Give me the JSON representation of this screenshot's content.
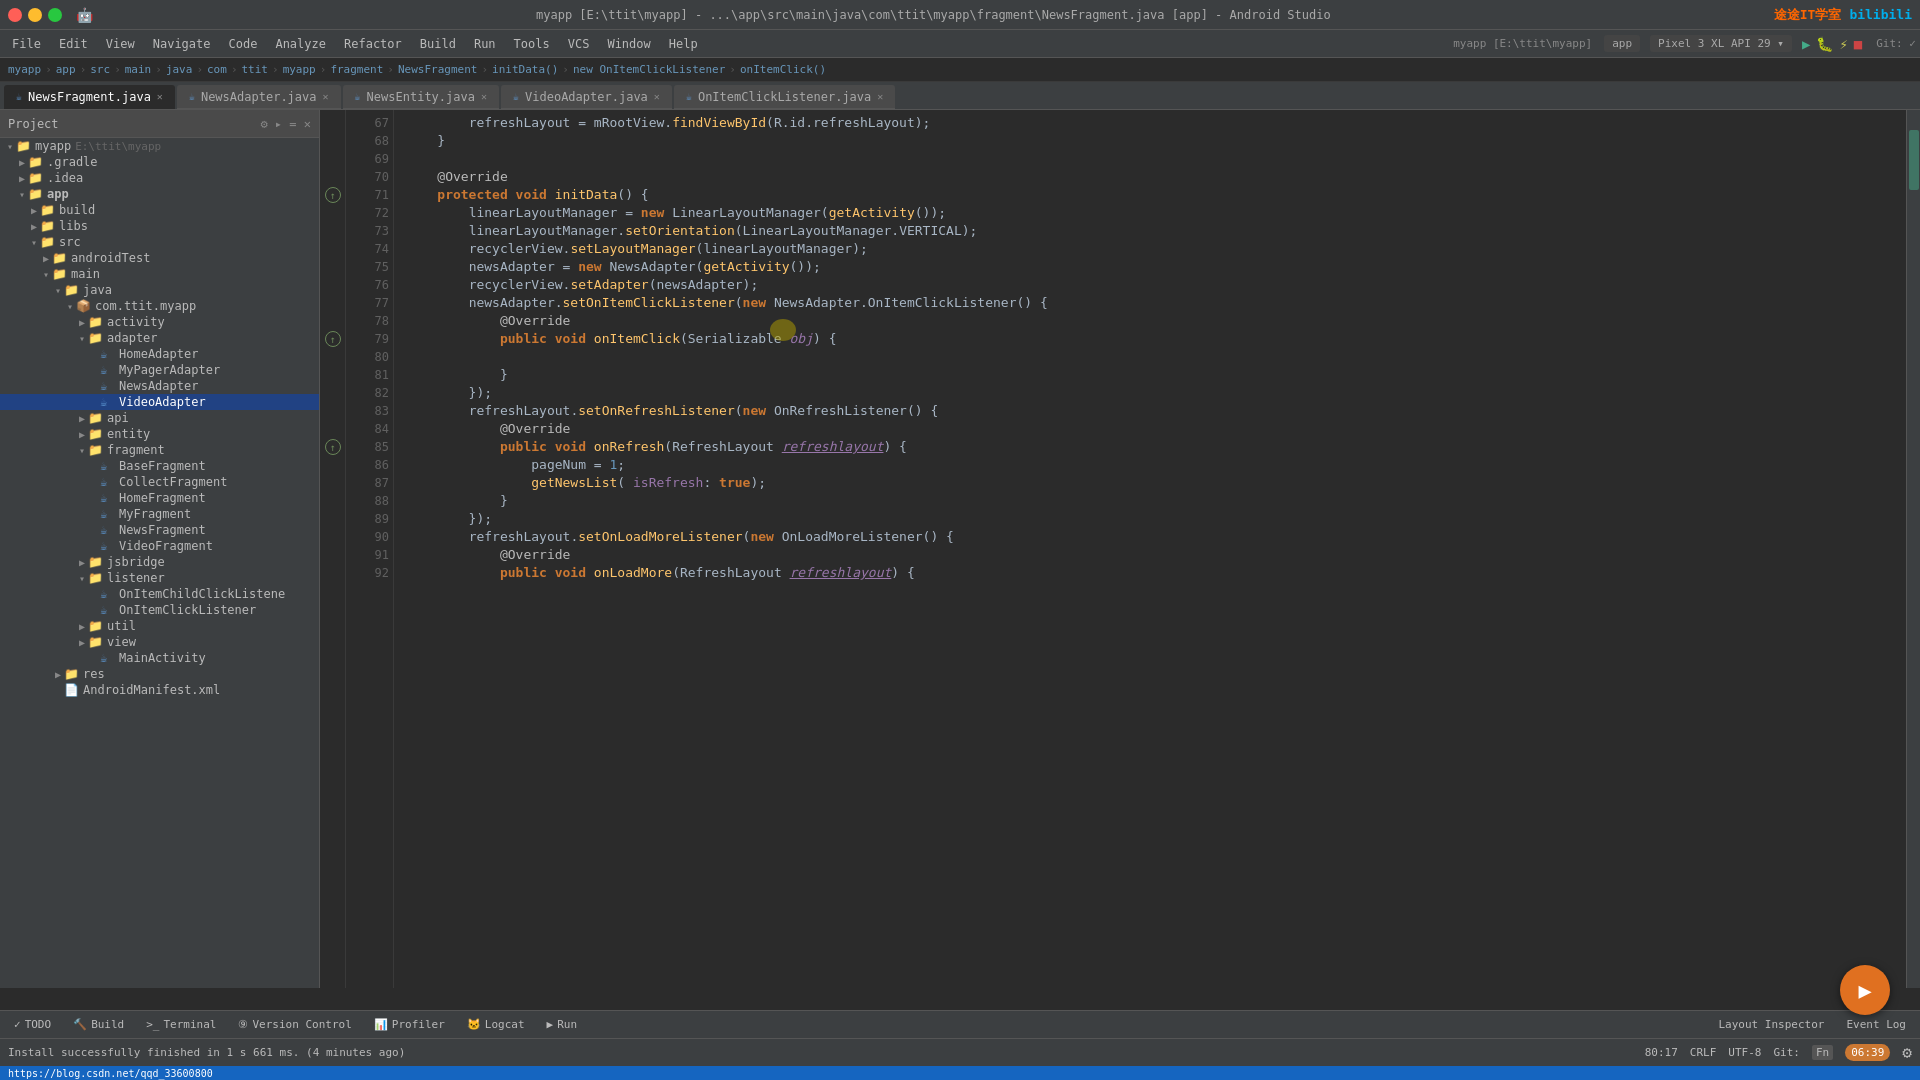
{
  "window": {
    "title": "myapp [E:\\ttit\\myapp] - ...\\app\\src\\main\\java\\com\\ttit\\myapp\\fragment\\NewsFragment.java [app] - Android Studio",
    "window_controls": [
      "close",
      "minimize",
      "maximize"
    ]
  },
  "menu": {
    "items": [
      "File",
      "Edit",
      "View",
      "Navigate",
      "Code",
      "Analyze",
      "Refactor",
      "Build",
      "Run",
      "Tools",
      "VCS",
      "Window",
      "Help"
    ]
  },
  "toolbar": {
    "project_name": "myapp",
    "device": "Pixel 3 XL API 29",
    "run_app": "app",
    "git_label": "Git:",
    "run_icon": "▶",
    "stop_icon": "■",
    "debug_icon": "🐛"
  },
  "breadcrumb": {
    "parts": [
      "myapp",
      "app",
      "src",
      "main",
      "java",
      "com",
      "ttit",
      "myapp",
      "fragment",
      "NewsFragment",
      "initData()",
      "new OnItemClickListener",
      "onItemClick()"
    ]
  },
  "tabs": [
    {
      "name": "NewsFragment.java",
      "active": true
    },
    {
      "name": "NewsAdapter.java",
      "active": false
    },
    {
      "name": "NewsEntity.java",
      "active": false
    },
    {
      "name": "VideoAdapter.java",
      "active": false
    },
    {
      "name": "OnItemClickListener.java",
      "active": false
    }
  ],
  "sidebar": {
    "header": "Project",
    "tree": [
      {
        "indent": 0,
        "icon": "folder",
        "name": "myapp",
        "path": "E:\\ttit\\myapp",
        "expanded": true
      },
      {
        "indent": 1,
        "icon": "folder",
        "name": ".gradle",
        "expanded": false
      },
      {
        "indent": 1,
        "icon": "folder",
        "name": ".idea",
        "expanded": false
      },
      {
        "indent": 1,
        "icon": "folder",
        "name": "app",
        "expanded": true,
        "bold": true
      },
      {
        "indent": 2,
        "icon": "folder",
        "name": "build",
        "expanded": false
      },
      {
        "indent": 2,
        "icon": "folder",
        "name": "libs",
        "expanded": false
      },
      {
        "indent": 2,
        "icon": "folder",
        "name": "src",
        "expanded": true
      },
      {
        "indent": 3,
        "icon": "folder",
        "name": "androidTest",
        "expanded": false
      },
      {
        "indent": 3,
        "icon": "folder",
        "name": "main",
        "expanded": true
      },
      {
        "indent": 4,
        "icon": "folder",
        "name": "java",
        "expanded": true
      },
      {
        "indent": 5,
        "icon": "package",
        "name": "com.ttit.myapp",
        "expanded": true
      },
      {
        "indent": 6,
        "icon": "folder",
        "name": "activity",
        "expanded": false
      },
      {
        "indent": 6,
        "icon": "folder",
        "name": "adapter",
        "expanded": true
      },
      {
        "indent": 7,
        "icon": "java",
        "name": "HomeAdapter",
        "expanded": false
      },
      {
        "indent": 7,
        "icon": "java",
        "name": "MyPagerAdapter",
        "expanded": false
      },
      {
        "indent": 7,
        "icon": "java",
        "name": "NewsAdapter",
        "expanded": false
      },
      {
        "indent": 7,
        "icon": "java",
        "name": "VideoAdapter",
        "expanded": false,
        "selected": true
      },
      {
        "indent": 6,
        "icon": "folder",
        "name": "api",
        "expanded": false
      },
      {
        "indent": 6,
        "icon": "folder",
        "name": "entity",
        "expanded": false
      },
      {
        "indent": 6,
        "icon": "folder",
        "name": "fragment",
        "expanded": true
      },
      {
        "indent": 7,
        "icon": "java",
        "name": "BaseFragment",
        "expanded": false
      },
      {
        "indent": 7,
        "icon": "java",
        "name": "CollectFragment",
        "expanded": false
      },
      {
        "indent": 7,
        "icon": "java",
        "name": "HomeFragment",
        "expanded": false
      },
      {
        "indent": 7,
        "icon": "java",
        "name": "MyFragment",
        "expanded": false
      },
      {
        "indent": 7,
        "icon": "java",
        "name": "NewsFragment",
        "expanded": false
      },
      {
        "indent": 7,
        "icon": "java",
        "name": "VideoFragment",
        "expanded": false
      },
      {
        "indent": 6,
        "icon": "folder",
        "name": "jsbridge",
        "expanded": false
      },
      {
        "indent": 6,
        "icon": "folder",
        "name": "listener",
        "expanded": true
      },
      {
        "indent": 7,
        "icon": "java",
        "name": "OnItemChildClickListene",
        "expanded": false
      },
      {
        "indent": 7,
        "icon": "java",
        "name": "OnItemClickListener",
        "expanded": false
      },
      {
        "indent": 6,
        "icon": "folder",
        "name": "util",
        "expanded": false
      },
      {
        "indent": 6,
        "icon": "folder",
        "name": "view",
        "expanded": false
      },
      {
        "indent": 7,
        "icon": "java",
        "name": "MainActivity",
        "expanded": false
      },
      {
        "indent": 4,
        "icon": "folder",
        "name": "res",
        "expanded": false
      },
      {
        "indent": 4,
        "icon": "xml",
        "name": "AndroidManifest.xml",
        "expanded": false
      }
    ]
  },
  "code": {
    "lines": [
      {
        "num": 67,
        "content": [
          {
            "t": "        "
          },
          {
            "t": "refreshLayout",
            "c": "var-name"
          },
          {
            "t": " = "
          },
          {
            "t": "mRootView",
            "c": "var-name"
          },
          {
            "t": "."
          },
          {
            "t": "findViewById",
            "c": "fn"
          },
          {
            "t": "(R.id."
          },
          {
            "t": "refreshLayout",
            "c": "var-name"
          },
          {
            "t": ");"
          }
        ]
      },
      {
        "num": 68,
        "content": [
          {
            "t": "    }"
          }
        ]
      },
      {
        "num": 69,
        "content": []
      },
      {
        "num": 70,
        "content": [
          {
            "t": "    "
          },
          {
            "t": "@Override",
            "c": "annotation"
          }
        ],
        "override": true
      },
      {
        "num": 71,
        "content": [
          {
            "t": "    "
          },
          {
            "t": "protected",
            "c": "kw"
          },
          {
            "t": " "
          },
          {
            "t": "void",
            "c": "kw"
          },
          {
            "t": " "
          },
          {
            "t": "initData",
            "c": "fn"
          },
          {
            "t": "() {"
          }
        ],
        "override": true
      },
      {
        "num": 72,
        "content": [
          {
            "t": "        "
          },
          {
            "t": "linearLayoutManager",
            "c": "var-name"
          },
          {
            "t": " = "
          },
          {
            "t": "new",
            "c": "kw"
          },
          {
            "t": " "
          },
          {
            "t": "LinearLayoutManager",
            "c": "class-name"
          },
          {
            "t": "("
          },
          {
            "t": "getActivity",
            "c": "fn"
          },
          {
            "t": "());"
          }
        ]
      },
      {
        "num": 73,
        "content": [
          {
            "t": "        "
          },
          {
            "t": "linearLayoutManager",
            "c": "var-name"
          },
          {
            "t": "."
          },
          {
            "t": "setOrientation",
            "c": "fn"
          },
          {
            "t": "("
          },
          {
            "t": "LinearLayoutManager",
            "c": "class-name"
          },
          {
            "t": "."
          },
          {
            "t": "VERTICAL",
            "c": "var-name"
          },
          {
            "t": ");"
          }
        ]
      },
      {
        "num": 74,
        "content": [
          {
            "t": "        "
          },
          {
            "t": "recyclerView",
            "c": "var-name"
          },
          {
            "t": "."
          },
          {
            "t": "setLayoutManager",
            "c": "fn"
          },
          {
            "t": "("
          },
          {
            "t": "linearLayoutManager",
            "c": "var-name"
          },
          {
            "t": ");"
          }
        ]
      },
      {
        "num": 75,
        "content": [
          {
            "t": "        "
          },
          {
            "t": "newsAdapter",
            "c": "var-name"
          },
          {
            "t": " = "
          },
          {
            "t": "new",
            "c": "kw"
          },
          {
            "t": " "
          },
          {
            "t": "NewsAdapter",
            "c": "class-name"
          },
          {
            "t": "("
          },
          {
            "t": "getActivity",
            "c": "fn"
          },
          {
            "t": "());"
          }
        ]
      },
      {
        "num": 76,
        "content": [
          {
            "t": "        "
          },
          {
            "t": "recyclerView",
            "c": "var-name"
          },
          {
            "t": "."
          },
          {
            "t": "setAdapter",
            "c": "fn"
          },
          {
            "t": "("
          },
          {
            "t": "newsAdapter",
            "c": "var-name"
          },
          {
            "t": ");"
          }
        ]
      },
      {
        "num": 77,
        "content": [
          {
            "t": "        "
          },
          {
            "t": "newsAdapter",
            "c": "var-name"
          },
          {
            "t": "."
          },
          {
            "t": "setOnItemClickListener",
            "c": "fn"
          },
          {
            "t": "("
          },
          {
            "t": "new",
            "c": "kw"
          },
          {
            "t": " "
          },
          {
            "t": "NewsAdapter",
            "c": "class-name"
          },
          {
            "t": "."
          },
          {
            "t": "OnItemClickListener",
            "c": "class-name"
          },
          {
            "t": "() {"
          }
        ]
      },
      {
        "num": 78,
        "content": [
          {
            "t": "            "
          },
          {
            "t": "@Override",
            "c": "annotation"
          }
        ],
        "override": true
      },
      {
        "num": 79,
        "content": [
          {
            "t": "            "
          },
          {
            "t": "public",
            "c": "kw"
          },
          {
            "t": " "
          },
          {
            "t": "void",
            "c": "kw"
          },
          {
            "t": " "
          },
          {
            "t": "onItemClick",
            "c": "fn"
          },
          {
            "t": "("
          },
          {
            "t": "Serializable",
            "c": "class-name"
          },
          {
            "t": " "
          },
          {
            "t": "obj",
            "c": "param"
          },
          {
            "t": ") {"
          }
        ],
        "override": true,
        "cursor": true
      },
      {
        "num": 80,
        "content": []
      },
      {
        "num": 81,
        "content": [
          {
            "t": "            }"
          }
        ]
      },
      {
        "num": 82,
        "content": [
          {
            "t": "        });"
          }
        ]
      },
      {
        "num": 83,
        "content": [
          {
            "t": "        "
          },
          {
            "t": "refreshLayout",
            "c": "var-name"
          },
          {
            "t": "."
          },
          {
            "t": "setOnRefreshListener",
            "c": "fn"
          },
          {
            "t": "("
          },
          {
            "t": "new",
            "c": "kw"
          },
          {
            "t": " "
          },
          {
            "t": "OnRefreshListener",
            "c": "class-name"
          },
          {
            "t": "() {"
          }
        ]
      },
      {
        "num": 84,
        "content": [
          {
            "t": "            "
          },
          {
            "t": "@Override",
            "c": "annotation"
          }
        ]
      },
      {
        "num": 85,
        "content": [
          {
            "t": "            "
          },
          {
            "t": "public",
            "c": "kw"
          },
          {
            "t": " "
          },
          {
            "t": "void",
            "c": "kw"
          },
          {
            "t": " "
          },
          {
            "t": "onRefresh",
            "c": "fn"
          },
          {
            "t": "("
          },
          {
            "t": "RefreshLayout",
            "c": "class-name"
          },
          {
            "t": " "
          },
          {
            "t": "refreshlayout",
            "c": "param",
            "underline": true
          },
          {
            "t": ") {"
          }
        ],
        "override": true
      },
      {
        "num": 86,
        "content": [
          {
            "t": "                "
          },
          {
            "t": "pageNum",
            "c": "var-name"
          },
          {
            "t": " = "
          },
          {
            "t": "1",
            "c": "num"
          },
          {
            "t": ";"
          }
        ]
      },
      {
        "num": 87,
        "content": [
          {
            "t": "                "
          },
          {
            "t": "getNewsList",
            "c": "fn"
          },
          {
            "t": "( "
          },
          {
            "t": "isRefresh",
            "c": "param"
          },
          {
            "t": ": "
          },
          {
            "t": "true",
            "c": "kw"
          },
          {
            "t": ");"
          }
        ]
      },
      {
        "num": 88,
        "content": [
          {
            "t": "            }"
          }
        ]
      },
      {
        "num": 89,
        "content": [
          {
            "t": "        });"
          }
        ]
      },
      {
        "num": 90,
        "content": [
          {
            "t": "        "
          },
          {
            "t": "refreshLayout",
            "c": "var-name"
          },
          {
            "t": "."
          },
          {
            "t": "setOnLoadMoreListener",
            "c": "fn"
          },
          {
            "t": "("
          },
          {
            "t": "new",
            "c": "kw"
          },
          {
            "t": " "
          },
          {
            "t": "OnLoadMoreListener",
            "c": "class-name"
          },
          {
            "t": "() {"
          }
        ]
      },
      {
        "num": 91,
        "content": [
          {
            "t": "            "
          },
          {
            "t": "@Override",
            "c": "annotation"
          }
        ]
      },
      {
        "num": 92,
        "content": [
          {
            "t": "            "
          },
          {
            "t": "public",
            "c": "kw"
          },
          {
            "t": " "
          },
          {
            "t": "void",
            "c": "kw"
          },
          {
            "t": " "
          },
          {
            "t": "onLoadMore",
            "c": "fn"
          },
          {
            "t": "("
          },
          {
            "t": "RefreshLayout",
            "c": "class-name"
          },
          {
            "t": " "
          },
          {
            "t": "refreshlayout",
            "c": "param",
            "underline": true
          },
          {
            "t": ") {"
          }
        ]
      }
    ]
  },
  "bottom_bar": {
    "tabs": [
      "TODO",
      "Build",
      "Terminal",
      "Version Control",
      "Profiler",
      "Logcat",
      "Run"
    ],
    "tab_icons": [
      "",
      "🔨",
      ">_",
      "↑",
      "📊",
      "🐱",
      "▶"
    ],
    "status": "Install successfully finished in 1 s 661 ms. (4 minutes ago)",
    "position": "80:17",
    "encoding": "CRLF",
    "charset": "UTF-8",
    "time": "06:39",
    "git": "Git:",
    "fn_text": "Fn"
  },
  "statusbar_bottom": {
    "items": [
      "Layout Inspector",
      "Event Log"
    ],
    "url": "https://blog.csdn.net/qqd_33600800"
  },
  "logos": {
    "left": "途途IT学室",
    "right": "bilibili"
  }
}
